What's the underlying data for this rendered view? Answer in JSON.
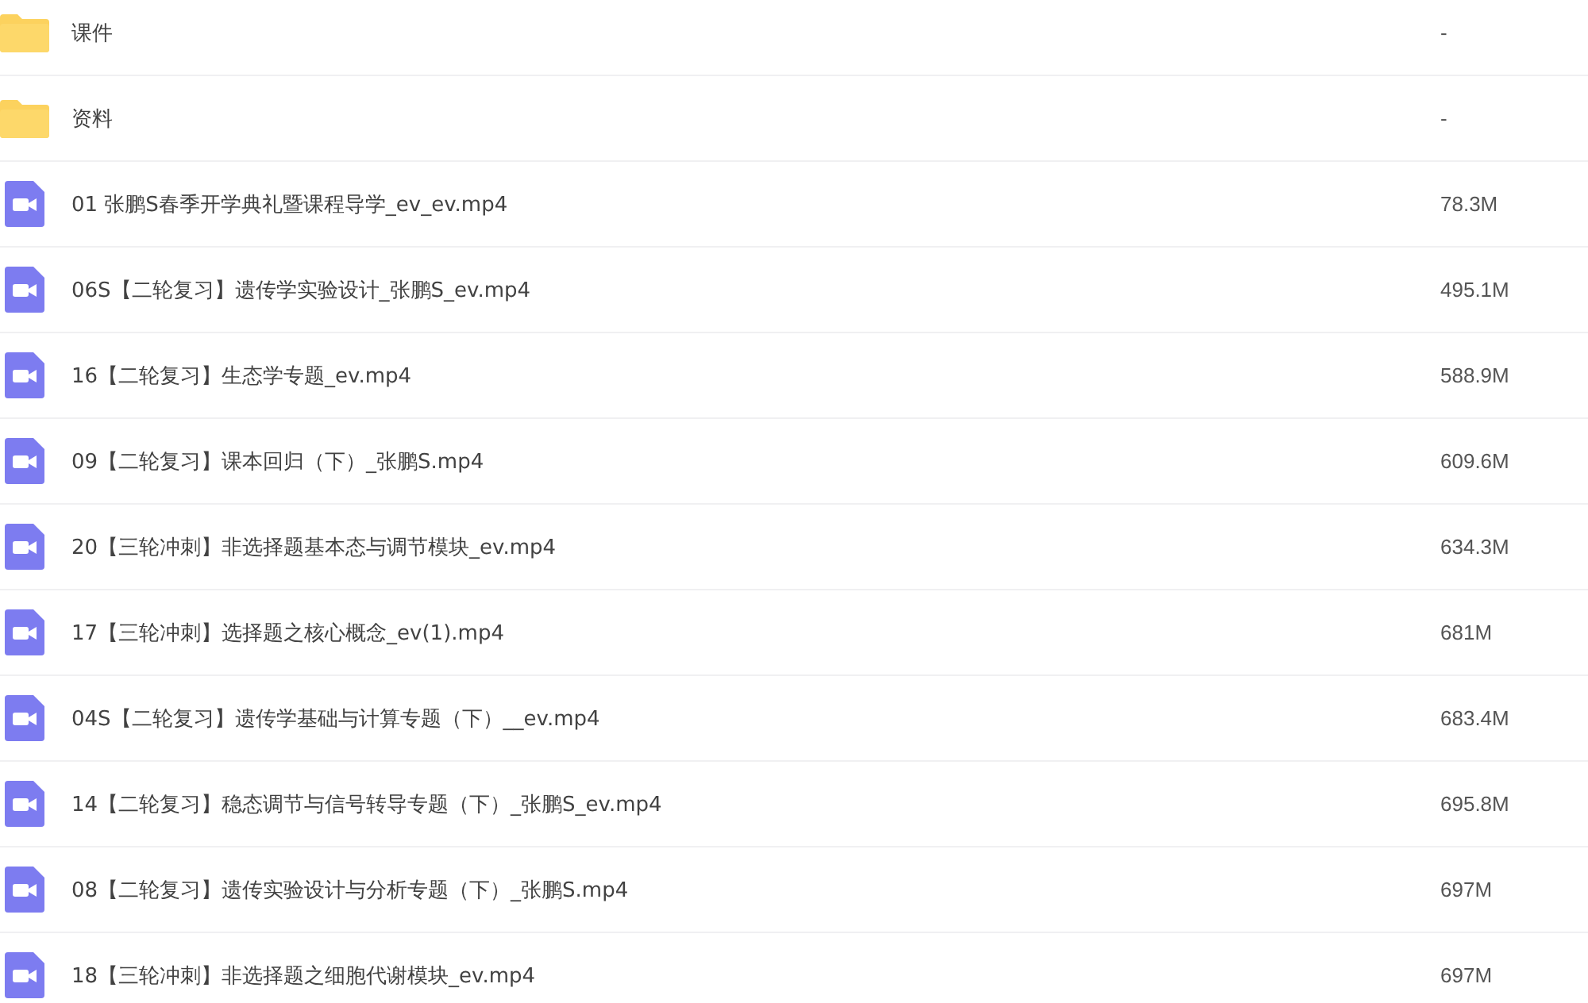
{
  "files": [
    {
      "kind": "folder",
      "name": "课件",
      "size": "-"
    },
    {
      "kind": "folder",
      "name": "资料",
      "size": "-"
    },
    {
      "kind": "video",
      "name": "01 张鹏S春季开学典礼暨课程导学_ev_ev.mp4",
      "size": "78.3M"
    },
    {
      "kind": "video",
      "name": "06S【二轮复习】遗传学实验设计_张鹏S_ev.mp4",
      "size": "495.1M"
    },
    {
      "kind": "video",
      "name": "16【二轮复习】生态学专题_ev.mp4",
      "size": "588.9M"
    },
    {
      "kind": "video",
      "name": "09【二轮复习】课本回归（下）_张鹏S.mp4",
      "size": "609.6M"
    },
    {
      "kind": "video",
      "name": "20【三轮冲刺】非选择题基本态与调节模块_ev.mp4",
      "size": "634.3M"
    },
    {
      "kind": "video",
      "name": "17【三轮冲刺】选择题之核心概念_ev(1).mp4",
      "size": "681M"
    },
    {
      "kind": "video",
      "name": "04S【二轮复习】遗传学基础与计算专题（下）__ev.mp4",
      "size": "683.4M"
    },
    {
      "kind": "video",
      "name": "14【二轮复习】稳态调节与信号转导专题（下）_张鹏S_ev.mp4",
      "size": "695.8M"
    },
    {
      "kind": "video",
      "name": "08【二轮复习】遗传实验设计与分析专题（下）_张鹏S.mp4",
      "size": "697M"
    },
    {
      "kind": "video",
      "name": "18【三轮冲刺】非选择题之细胞代谢模块_ev.mp4",
      "size": "697M"
    }
  ]
}
